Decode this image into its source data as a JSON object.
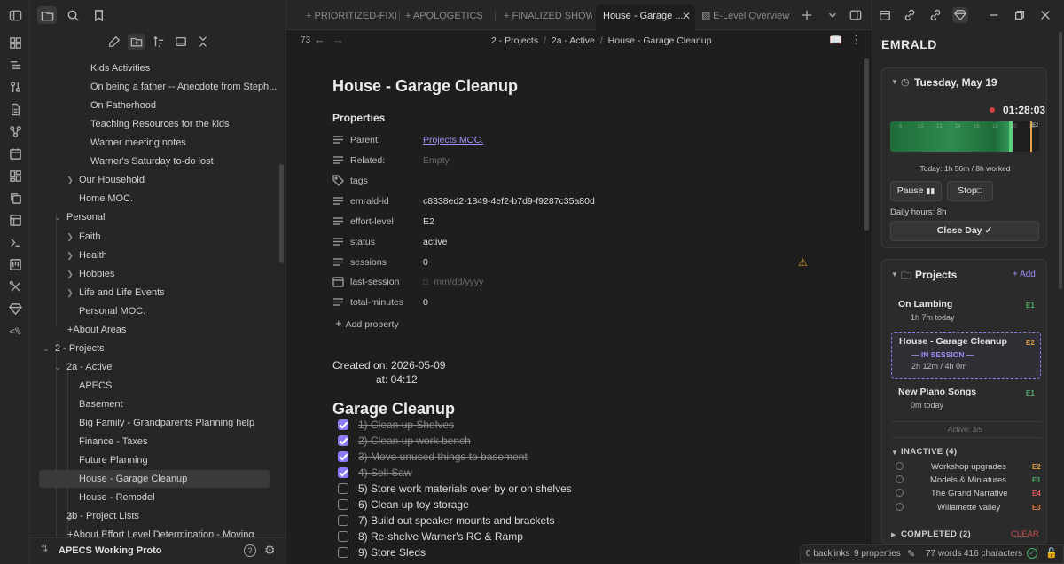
{
  "left_sidebar": {
    "tree": [
      {
        "label": "Kids Activities"
      },
      {
        "label": "On being a father -- Anecdote from Steph..."
      },
      {
        "label": "On Fatherhood"
      },
      {
        "label": "Teaching Resources for the kids"
      },
      {
        "label": "Warner meeting notes"
      },
      {
        "label": "Warner's Saturday to-do lost"
      },
      {
        "label": "Our Household"
      },
      {
        "label": "Home MOC."
      },
      {
        "label": "Personal"
      },
      {
        "label": "Faith"
      },
      {
        "label": "Health"
      },
      {
        "label": "Hobbies"
      },
      {
        "label": "Life and Life Events"
      },
      {
        "label": "Personal MOC."
      },
      {
        "label": "+About Areas"
      },
      {
        "label": "2 - Projects"
      },
      {
        "label": "2a - Active"
      },
      {
        "label": "APECS"
      },
      {
        "label": "Basement"
      },
      {
        "label": "Big Family - Grandparents Planning help"
      },
      {
        "label": "Finance - Taxes"
      },
      {
        "label": "Future Planning"
      },
      {
        "label": "House - Garage Cleanup"
      },
      {
        "label": "House - Remodel"
      },
      {
        "label": "2b - Project Lists"
      },
      {
        "label": "+About Effort Level Determination - Moving th..."
      }
    ],
    "vault_name": "APECS Working Proto"
  },
  "tabs": [
    {
      "label": "+ PRIORITIZED-FIXES"
    },
    {
      "label": "+ APOLOGETICS"
    },
    {
      "label": "+ FINALIZED SHOW..."
    },
    {
      "label": "House - Garage ..."
    },
    {
      "label": "E-Level Overview"
    }
  ],
  "editor": {
    "line_number": "73",
    "breadcrumb": [
      "2 - Projects",
      "/",
      "2a - Active",
      "/",
      "House - Garage Cleanup"
    ],
    "title": "House - Garage Cleanup",
    "properties_heading": "Properties",
    "properties": [
      {
        "key": "Parent:",
        "value": "Projects MOC."
      },
      {
        "key": "Related:",
        "value": "Empty"
      },
      {
        "key": "tags",
        "value": ""
      },
      {
        "key": "emrald-id",
        "value": "c8338ed2-1849-4ef2-b7d9-f9287c35a80d"
      },
      {
        "key": "effort-level",
        "value": "E2"
      },
      {
        "key": "status",
        "value": "active"
      },
      {
        "key": "sessions",
        "value": "0"
      },
      {
        "key": "last-session",
        "value": "mm/dd/yyyy"
      },
      {
        "key": "total-minutes",
        "value": "0"
      }
    ],
    "add_property": "Add property",
    "created_on": "Created on: 2026-05-09",
    "created_at": "at: 04:12",
    "section_heading": "Garage Cleanup",
    "tasks": [
      {
        "text": "1) Clean up Shelves",
        "done": true
      },
      {
        "text": "2) Clean  up work bench",
        "done": true
      },
      {
        "text": "3) Move unused things to basement",
        "done": true
      },
      {
        "text": "4) Sell Saw",
        "done": true
      },
      {
        "text": "5) Store work materials over by or on shelves",
        "done": false
      },
      {
        "text": "6) Clean up toy storage",
        "done": false
      },
      {
        "text": "7) Build out speaker mounts and brackets",
        "done": false
      },
      {
        "text": "8) Re-shelve Warner's RC & Ramp",
        "done": false
      },
      {
        "text": "9) Store Sleds",
        "done": false
      }
    ]
  },
  "right_sidebar": {
    "title": "EMRALD",
    "day_label": "Tuesday, May 19",
    "timer": "01:28:03",
    "timeline_ticks": [
      "6",
      "10",
      "12",
      "14",
      "16",
      "18",
      "20",
      "22"
    ],
    "timeline_marker": "E2",
    "today_worked": "Today: 1h 56m / 8h worked",
    "pause_label": "Pause",
    "stop_label": "Stop",
    "daily_hours": "Daily hours: 8h",
    "close_day_label": "Close Day",
    "projects_heading": "Projects",
    "add_label": "+ Add",
    "projects": [
      {
        "name": "On Lambing",
        "time": "1h 7m today",
        "level": "E1"
      },
      {
        "name": "House - Garage Cleanup",
        "session": "— IN SESSION —",
        "time": "2h 12m / 4h 0m",
        "level": "E2"
      },
      {
        "name": "New Piano Songs",
        "time": "0m today",
        "level": "E1"
      }
    ],
    "active_count": "Active: 3/5",
    "inactive_heading": "INACTIVE (4)",
    "inactive": [
      {
        "name": "Workshop upgrades",
        "level": "E2"
      },
      {
        "name": "Models & Miniatures",
        "level": "E1"
      },
      {
        "name": "The Grand Narrative",
        "level": "E4"
      },
      {
        "name": "Willamette valley",
        "level": "E3"
      }
    ],
    "completed_heading": "COMPLETED (2)",
    "clear_label": "CLEAR"
  },
  "status_bar": {
    "backlinks": "0 backlinks",
    "properties": "9 properties",
    "words": "77 words",
    "characters": "416 characters"
  },
  "colors": {
    "accent": "#8b7cf6",
    "E1": "#4caf6a",
    "E2": "#e0a040",
    "E3": "#e07a40",
    "E4": "#e05a5a",
    "timeline_green": "#2e8b4e"
  }
}
